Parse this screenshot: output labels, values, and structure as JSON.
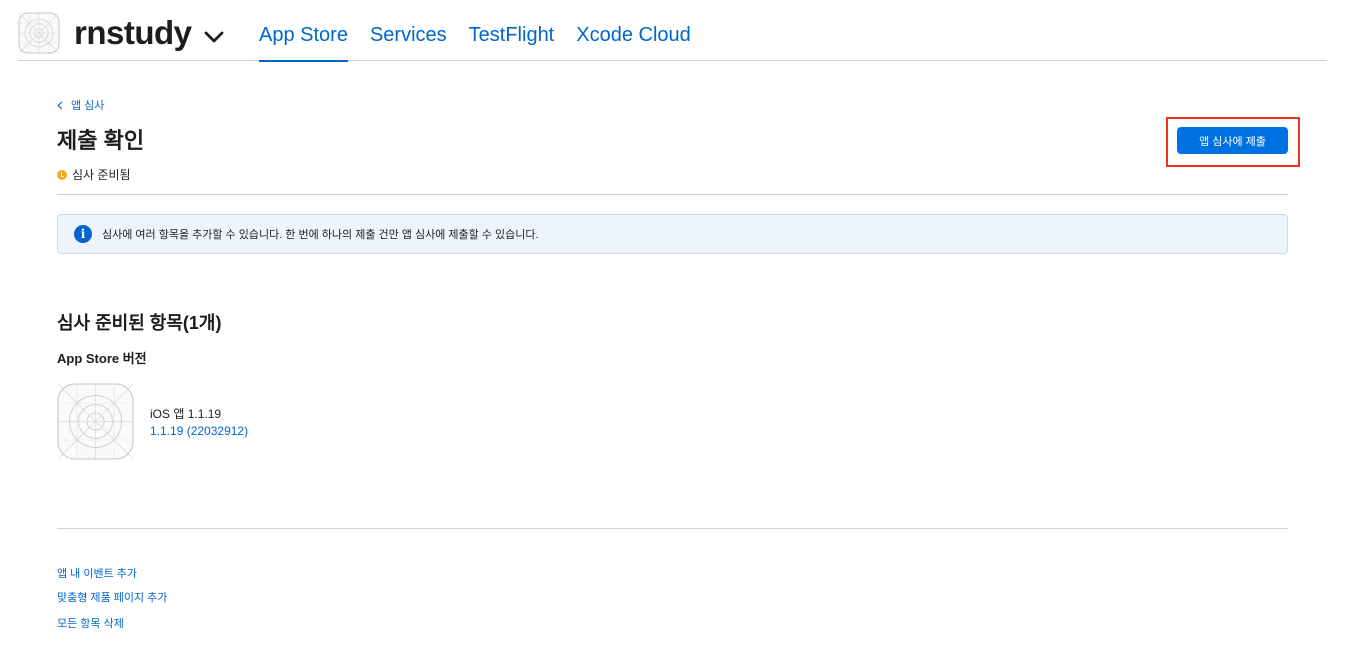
{
  "header": {
    "app_name": "rnstudy",
    "tabs": [
      {
        "label": "App Store",
        "active": true
      },
      {
        "label": "Services",
        "active": false
      },
      {
        "label": "TestFlight",
        "active": false
      },
      {
        "label": "Xcode Cloud",
        "active": false
      }
    ]
  },
  "main": {
    "back_label": "앱 심사",
    "title": "제출 확인",
    "status": "심사 준비됨",
    "submit_button": "앱 심사에 제출",
    "info_message": "심사에 여러 항목을 추가할 수 있습니다. 한 번에 하나의 제출 건만 앱 심사에 제출할 수 있습니다.",
    "section_title": "심사 준비된 항목(1개)",
    "subsection_title": "App Store 버전",
    "item": {
      "name": "iOS 앱 1.1.19",
      "build": "1.1.19 (22032912)"
    }
  },
  "footer": {
    "links": [
      "앱 내 이벤트 추가",
      "맞춤형 제품 페이지 추가",
      "모든 항목 삭제"
    ]
  },
  "colors": {
    "accent": "#0066cc",
    "button": "#0071e3",
    "status_ready": "#f5a623",
    "highlight": "#e8341c"
  },
  "icons": [
    "app-placeholder-icon",
    "chevron-down-icon",
    "chevron-left-icon",
    "info-icon"
  ]
}
